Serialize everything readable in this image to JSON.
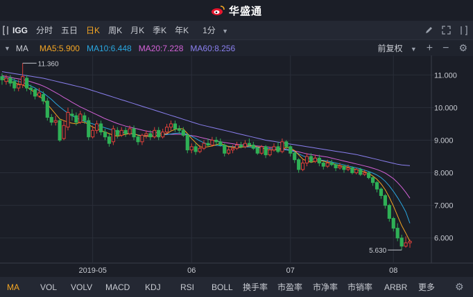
{
  "app": {
    "brand": "华盛通"
  },
  "toolbar": {
    "ticker": "IGG",
    "periods": [
      "分时",
      "五日",
      "日K",
      "周K",
      "月K",
      "季K",
      "年K"
    ],
    "active_period": 2,
    "minute_selector": "1分"
  },
  "indicator_bar": {
    "name": "MA",
    "ma5": "MA5:5.900",
    "ma10": "MA10:6.448",
    "ma20": "MA20:7.228",
    "ma60": "MA60:8.256",
    "adjust": "前复权",
    "colors": {
      "ma5": "#f5a623",
      "ma10": "#2aa7e0",
      "ma20": "#d462d8",
      "ma60": "#8b80f0"
    }
  },
  "chart_data": {
    "type": "candlestick",
    "price_axis": [
      "11.000",
      "10.000",
      "9.000",
      "8.000",
      "7.000",
      "6.000"
    ],
    "ylim": [
      5.4,
      11.6
    ],
    "date_axis": [
      "2019-05",
      "06",
      "07",
      "08"
    ],
    "high_label": "11.360",
    "low_label": "5.630",
    "colors": {
      "up": "#e0413a",
      "down": "#2fb056"
    },
    "candles": [
      [
        10.95,
        10.85,
        11.05,
        10.7
      ],
      [
        10.8,
        10.9,
        11.0,
        10.7
      ],
      [
        10.9,
        10.75,
        11.0,
        10.65
      ],
      [
        10.8,
        10.6,
        10.9,
        10.5
      ],
      [
        10.6,
        10.7,
        10.85,
        10.5
      ],
      [
        10.7,
        10.95,
        11.36,
        10.6
      ],
      [
        10.9,
        10.6,
        11.0,
        10.5
      ],
      [
        10.6,
        10.55,
        10.7,
        10.4
      ],
      [
        10.55,
        10.35,
        10.6,
        10.25
      ],
      [
        10.35,
        10.45,
        10.6,
        10.3
      ],
      [
        10.4,
        10.2,
        10.5,
        10.1
      ],
      [
        10.2,
        9.7,
        10.3,
        9.6
      ],
      [
        9.7,
        9.55,
        9.8,
        9.45
      ],
      [
        9.55,
        9.6,
        9.75,
        9.45
      ],
      [
        9.6,
        9.0,
        9.65,
        8.95
      ],
      [
        9.05,
        9.45,
        9.6,
        9.0
      ],
      [
        9.4,
        9.85,
        10.0,
        9.3
      ],
      [
        9.8,
        9.75,
        9.95,
        9.6
      ],
      [
        9.75,
        9.55,
        9.85,
        9.45
      ],
      [
        9.55,
        9.8,
        9.9,
        9.5
      ],
      [
        9.75,
        9.6,
        9.85,
        9.5
      ],
      [
        9.6,
        9.1,
        9.7,
        9.0
      ],
      [
        9.1,
        9.3,
        9.45,
        9.05
      ],
      [
        9.3,
        9.5,
        9.6,
        9.2
      ],
      [
        9.5,
        9.25,
        9.6,
        9.15
      ],
      [
        9.25,
        9.1,
        9.35,
        9.0
      ],
      [
        9.1,
        8.9,
        9.2,
        8.8
      ],
      [
        8.95,
        9.35,
        9.45,
        8.85
      ],
      [
        9.3,
        9.15,
        9.4,
        9.05
      ],
      [
        9.15,
        9.3,
        9.4,
        9.1
      ],
      [
        9.3,
        9.2,
        9.4,
        9.1
      ],
      [
        9.2,
        9.35,
        9.45,
        9.15
      ],
      [
        9.35,
        9.1,
        9.45,
        9.0
      ],
      [
        9.1,
        8.95,
        9.15,
        8.85
      ],
      [
        8.95,
        9.15,
        9.2,
        8.85
      ],
      [
        9.15,
        9.2,
        9.3,
        9.05
      ],
      [
        9.2,
        9.1,
        9.3,
        9.0
      ],
      [
        9.1,
        9.3,
        9.4,
        9.05
      ],
      [
        9.3,
        9.1,
        9.4,
        9.0
      ],
      [
        9.1,
        9.25,
        9.35,
        9.05
      ],
      [
        9.25,
        9.4,
        9.5,
        9.2
      ],
      [
        9.4,
        9.5,
        9.6,
        9.3
      ],
      [
        9.5,
        9.35,
        9.6,
        9.25
      ],
      [
        9.35,
        9.3,
        9.45,
        9.2
      ],
      [
        9.3,
        9.15,
        9.4,
        9.1
      ],
      [
        9.15,
        8.7,
        9.2,
        8.6
      ],
      [
        8.7,
        8.8,
        8.9,
        8.6
      ],
      [
        8.8,
        8.65,
        8.9,
        8.55
      ],
      [
        8.65,
        8.75,
        8.85,
        8.6
      ],
      [
        8.75,
        8.9,
        9.0,
        8.7
      ],
      [
        8.9,
        8.85,
        9.05,
        8.8
      ],
      [
        8.85,
        9.0,
        9.1,
        8.8
      ],
      [
        9.0,
        8.95,
        9.1,
        8.85
      ],
      [
        8.95,
        8.85,
        9.05,
        8.8
      ],
      [
        8.85,
        8.6,
        8.9,
        8.5
      ],
      [
        8.6,
        8.7,
        8.8,
        8.55
      ],
      [
        8.7,
        8.75,
        8.85,
        8.6
      ],
      [
        8.75,
        8.85,
        8.95,
        8.7
      ],
      [
        8.85,
        8.8,
        8.95,
        8.75
      ],
      [
        8.8,
        8.9,
        9.0,
        8.75
      ],
      [
        8.9,
        8.85,
        9.05,
        8.8
      ],
      [
        8.85,
        8.75,
        8.95,
        8.7
      ],
      [
        8.75,
        8.6,
        8.8,
        8.55
      ],
      [
        8.6,
        8.8,
        8.85,
        8.55
      ],
      [
        8.8,
        8.55,
        8.85,
        8.45
      ],
      [
        8.55,
        8.7,
        8.8,
        8.5
      ],
      [
        8.7,
        8.8,
        8.9,
        8.65
      ],
      [
        8.8,
        8.65,
        8.95,
        8.6
      ],
      [
        8.65,
        8.95,
        9.05,
        8.6
      ],
      [
        8.95,
        8.8,
        9.0,
        8.7
      ],
      [
        8.8,
        8.6,
        8.85,
        8.5
      ],
      [
        8.6,
        8.4,
        8.65,
        8.3
      ],
      [
        8.4,
        8.1,
        8.45,
        8.0
      ],
      [
        8.1,
        8.3,
        8.4,
        8.05
      ],
      [
        8.3,
        8.5,
        8.6,
        8.2
      ],
      [
        8.5,
        8.35,
        8.6,
        8.3
      ],
      [
        8.35,
        8.45,
        8.55,
        8.3
      ],
      [
        8.45,
        8.3,
        8.55,
        8.2
      ],
      [
        8.3,
        8.2,
        8.35,
        8.1
      ],
      [
        8.2,
        8.3,
        8.4,
        8.15
      ],
      [
        8.3,
        8.25,
        8.4,
        8.2
      ],
      [
        8.25,
        8.15,
        8.3,
        8.05
      ],
      [
        8.15,
        8.2,
        8.3,
        8.1
      ],
      [
        8.2,
        8.1,
        8.25,
        8.0
      ],
      [
        8.1,
        8.15,
        8.25,
        8.05
      ],
      [
        8.15,
        8.0,
        8.2,
        7.95
      ],
      [
        8.0,
        8.1,
        8.15,
        7.95
      ],
      [
        8.1,
        7.95,
        8.15,
        7.9
      ],
      [
        7.95,
        8.0,
        8.1,
        7.9
      ],
      [
        8.0,
        7.85,
        8.05,
        7.8
      ],
      [
        7.85,
        7.7,
        7.9,
        7.6
      ],
      [
        7.7,
        7.5,
        7.75,
        7.4
      ],
      [
        7.5,
        7.3,
        7.55,
        7.2
      ],
      [
        7.3,
        7.0,
        7.35,
        6.9
      ],
      [
        7.0,
        6.6,
        7.05,
        6.5
      ],
      [
        6.6,
        6.3,
        6.65,
        6.2
      ],
      [
        6.3,
        6.0,
        6.45,
        5.9
      ],
      [
        6.0,
        5.75,
        6.1,
        5.63
      ],
      [
        5.75,
        5.85,
        6.05,
        5.7
      ],
      [
        5.85,
        5.9,
        5.95,
        5.7
      ]
    ],
    "ma5": [
      10.9,
      10.82,
      10.8,
      10.75,
      10.72,
      10.7,
      10.62,
      10.55,
      10.45,
      10.35,
      10.25,
      10.1,
      9.95,
      9.8,
      9.65,
      9.6,
      9.55,
      9.52,
      9.5,
      9.55,
      9.55,
      9.48,
      9.4,
      9.35,
      9.3,
      9.25,
      9.2,
      9.15,
      9.12,
      9.15,
      9.18,
      9.2,
      9.2,
      9.15,
      9.12,
      9.12,
      9.12,
      9.12,
      9.15,
      9.17,
      9.2,
      9.28,
      9.33,
      9.36,
      9.34,
      9.2,
      9.05,
      8.92,
      8.8,
      8.78,
      8.8,
      8.82,
      8.86,
      8.9,
      8.85,
      8.8,
      8.78,
      8.77,
      8.78,
      8.8,
      8.82,
      8.82,
      8.79,
      8.77,
      8.72,
      8.7,
      8.7,
      8.7,
      8.72,
      8.78,
      8.76,
      8.68,
      8.55,
      8.42,
      8.36,
      8.32,
      8.35,
      8.37,
      8.36,
      8.32,
      8.3,
      8.25,
      8.22,
      8.2,
      8.17,
      8.13,
      8.1,
      8.06,
      8.03,
      7.98,
      7.9,
      7.8,
      7.66,
      7.48,
      7.25,
      6.98,
      6.68,
      6.38,
      6.15,
      5.9
    ],
    "ma10": [
      10.95,
      10.9,
      10.88,
      10.84,
      10.8,
      10.77,
      10.72,
      10.66,
      10.6,
      10.52,
      10.45,
      10.35,
      10.25,
      10.13,
      10.02,
      9.92,
      9.83,
      9.75,
      9.68,
      9.63,
      9.58,
      9.54,
      9.5,
      9.46,
      9.42,
      9.38,
      9.34,
      9.3,
      9.27,
      9.24,
      9.22,
      9.2,
      9.18,
      9.16,
      9.14,
      9.13,
      9.13,
      9.14,
      9.15,
      9.16,
      9.17,
      9.19,
      9.21,
      9.22,
      9.21,
      9.18,
      9.12,
      9.05,
      8.98,
      8.92,
      8.88,
      8.85,
      8.84,
      8.83,
      8.82,
      8.81,
      8.8,
      8.8,
      8.79,
      8.79,
      8.79,
      8.78,
      8.77,
      8.76,
      8.75,
      8.74,
      8.73,
      8.72,
      8.71,
      8.7,
      8.68,
      8.64,
      8.58,
      8.52,
      8.47,
      8.43,
      8.41,
      8.4,
      8.38,
      8.36,
      8.33,
      8.3,
      8.27,
      8.24,
      8.21,
      8.18,
      8.15,
      8.12,
      8.08,
      8.04,
      7.99,
      7.93,
      7.85,
      7.74,
      7.6,
      7.43,
      7.24,
      7.03,
      6.8,
      6.45
    ],
    "ma20": [
      10.98,
      10.95,
      10.93,
      10.9,
      10.88,
      10.86,
      10.83,
      10.79,
      10.75,
      10.71,
      10.66,
      10.6,
      10.53,
      10.46,
      10.39,
      10.31,
      10.24,
      10.16,
      10.09,
      10.02,
      9.96,
      9.9,
      9.84,
      9.78,
      9.72,
      9.66,
      9.61,
      9.56,
      9.51,
      9.47,
      9.43,
      9.4,
      9.37,
      9.34,
      9.31,
      9.28,
      9.26,
      9.24,
      9.22,
      9.2,
      9.19,
      9.18,
      9.18,
      9.18,
      9.17,
      9.16,
      9.14,
      9.12,
      9.09,
      9.06,
      9.03,
      9.0,
      8.97,
      8.95,
      8.93,
      8.91,
      8.89,
      8.87,
      8.86,
      8.85,
      8.84,
      8.83,
      8.82,
      8.81,
      8.8,
      8.78,
      8.77,
      8.75,
      8.74,
      8.72,
      8.7,
      8.67,
      8.64,
      8.61,
      8.58,
      8.56,
      8.54,
      8.52,
      8.5,
      8.48,
      8.45,
      8.42,
      8.39,
      8.36,
      8.33,
      8.3,
      8.27,
      8.24,
      8.21,
      8.18,
      8.14,
      8.1,
      8.05,
      7.99,
      7.91,
      7.82,
      7.7,
      7.56,
      7.4,
      7.22
    ],
    "ma60": [
      11.1,
      11.08,
      11.06,
      11.04,
      11.02,
      11.0,
      10.98,
      10.96,
      10.94,
      10.92,
      10.9,
      10.87,
      10.84,
      10.81,
      10.78,
      10.75,
      10.72,
      10.69,
      10.66,
      10.63,
      10.6,
      10.56,
      10.52,
      10.48,
      10.44,
      10.4,
      10.36,
      10.32,
      10.28,
      10.24,
      10.2,
      10.16,
      10.12,
      10.08,
      10.04,
      10.0,
      9.96,
      9.92,
      9.88,
      9.84,
      9.8,
      9.76,
      9.72,
      9.68,
      9.64,
      9.6,
      9.56,
      9.52,
      9.48,
      9.45,
      9.42,
      9.39,
      9.36,
      9.33,
      9.3,
      9.27,
      9.24,
      9.21,
      9.18,
      9.15,
      9.12,
      9.09,
      9.06,
      9.03,
      9.0,
      8.98,
      8.96,
      8.94,
      8.92,
      8.9,
      8.88,
      8.86,
      8.84,
      8.82,
      8.8,
      8.78,
      8.76,
      8.74,
      8.72,
      8.7,
      8.68,
      8.66,
      8.64,
      8.62,
      8.6,
      8.58,
      8.56,
      8.53,
      8.5,
      8.47,
      8.44,
      8.41,
      8.38,
      8.35,
      8.32,
      8.29,
      8.26,
      8.24,
      8.23,
      8.22
    ]
  },
  "bottom_tabs": [
    "MA",
    "VOL",
    "VOLV",
    "MACD",
    "KDJ",
    "RSI",
    "BOLL",
    "换手率",
    "市盈率",
    "市净率",
    "市销率",
    "ARBR",
    "更多"
  ],
  "active_bottom_tab": 0
}
